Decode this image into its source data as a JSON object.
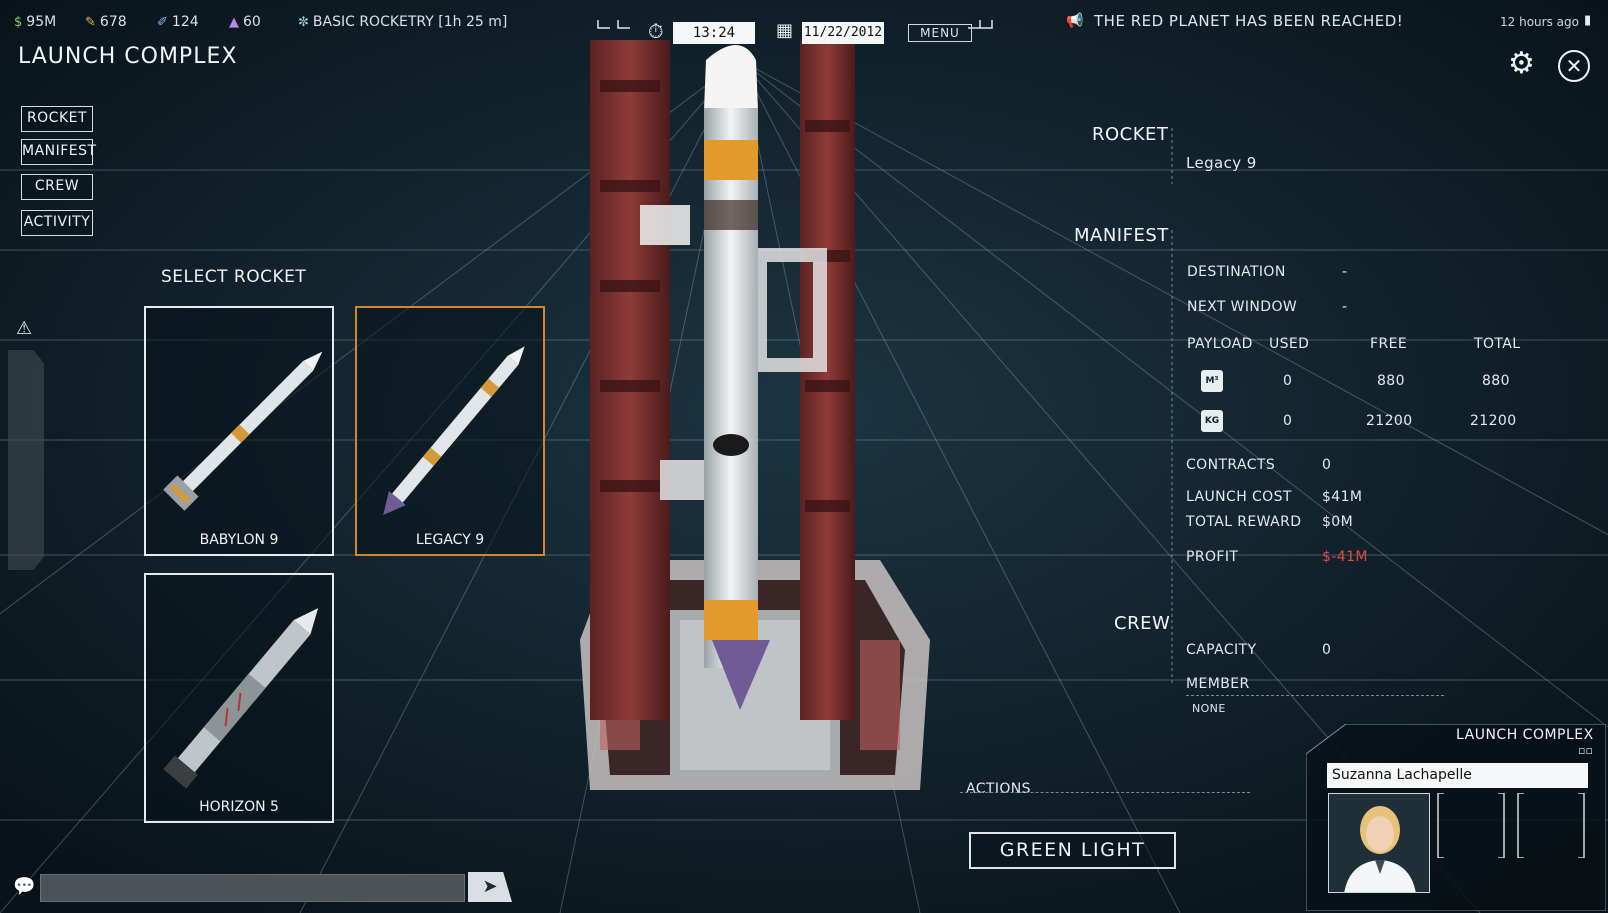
{
  "topbar": {
    "money": "95M",
    "resource_b": "678",
    "resource_c": "124",
    "resource_d": "60",
    "research": "BASIC ROCKETRY [1h 25 m]",
    "clock": "13:24",
    "date": "11/22/2012",
    "menu_label": "MENU",
    "news": "THE RED PLANET HAS BEEN REACHED!",
    "news_time": "12 hours ago"
  },
  "page": {
    "title": "LAUNCH COMPLEX"
  },
  "side_nav": [
    "ROCKET",
    "MANIFEST",
    "CREW",
    "ACTIVITY"
  ],
  "select_rocket": {
    "label": "SELECT ROCKET",
    "rockets": [
      {
        "name": "BABYLON 9",
        "selected": false
      },
      {
        "name": "LEGACY 9",
        "selected": true
      },
      {
        "name": "HORIZON 5",
        "selected": false
      }
    ]
  },
  "info": {
    "rocket_header": "ROCKET",
    "rocket_name": "Legacy 9",
    "manifest_header": "MANIFEST",
    "destination_label": "DESTINATION",
    "destination_value": "-",
    "next_window_label": "NEXT WINDOW",
    "next_window_value": "-",
    "payload_label": "PAYLOAD",
    "used_label": "USED",
    "free_label": "FREE",
    "total_label": "TOTAL",
    "volume_unit": "M³",
    "volume_used": "0",
    "volume_free": "880",
    "volume_total": "880",
    "mass_unit": "KG",
    "mass_used": "0",
    "mass_free": "21200",
    "mass_total": "21200",
    "contracts_label": "CONTRACTS",
    "contracts_value": "0",
    "launch_cost_label": "LAUNCH COST",
    "launch_cost_value": "$41M",
    "total_reward_label": "TOTAL REWARD",
    "total_reward_value": "$0M",
    "profit_label": "PROFIT",
    "profit_value": "$-41M",
    "crew_header": "CREW",
    "capacity_label": "CAPACITY",
    "capacity_value": "0",
    "member_label": "MEMBER",
    "member_value": "NONE"
  },
  "actions": {
    "label": "ACTIONS",
    "green_light": "GREEN LIGHT"
  },
  "character": {
    "panel_title": "LAUNCH COMPLEX",
    "name": "Suzanna Lachapelle"
  },
  "colors": {
    "accent": "#d4862d",
    "profit_negative": "#e0483f",
    "background": "#0c1a22"
  }
}
